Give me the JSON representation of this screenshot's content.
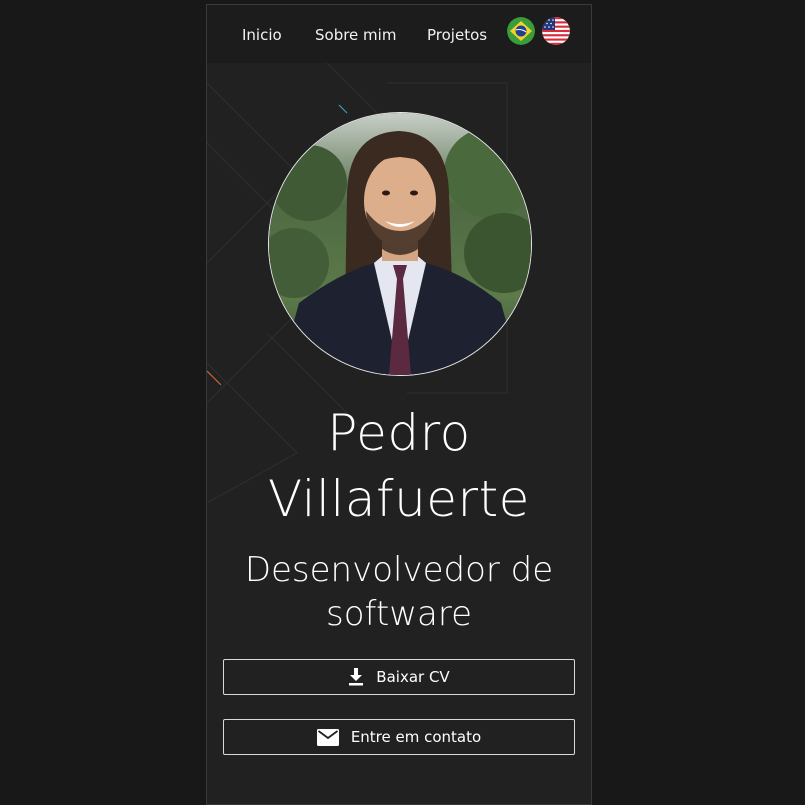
{
  "nav": {
    "items": [
      {
        "label": "Inicio"
      },
      {
        "label": "Sobre mim"
      },
      {
        "label": "Projetos"
      }
    ],
    "languages": [
      {
        "icon": "brazil-flag-icon"
      },
      {
        "icon": "usa-flag-icon"
      }
    ]
  },
  "profile": {
    "avatar_icon": "profile-photo",
    "first_name": "Pedro",
    "last_name": "Villafuerte",
    "role_line1": "Desenvolvedor de",
    "role_line2": "software"
  },
  "actions": {
    "download_cv": {
      "label": "Baixar CV",
      "icon": "download-icon"
    },
    "contact": {
      "label": "Entre em contato",
      "icon": "mail-icon"
    }
  },
  "colors": {
    "page_background": "#181818",
    "card_background": "#212121",
    "nav_background": "#1c1c1c",
    "text": "#ffffff"
  }
}
